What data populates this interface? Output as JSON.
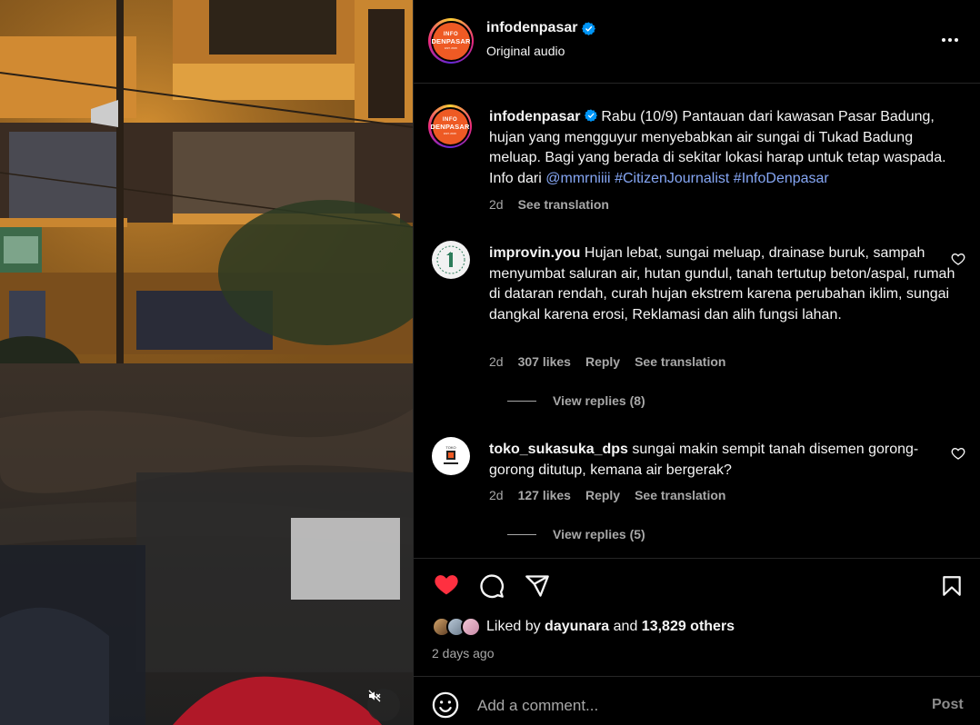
{
  "post": {
    "username": "infodenpasar",
    "audio": "Original audio",
    "avatar_logo": {
      "line1": "INFO",
      "line2": "DENPASAR",
      "line3": "EST. 2015"
    }
  },
  "caption": {
    "username": "infodenpasar",
    "text": "Rabu (10/9) Pantauan dari kawasan Pasar Badung, hujan yang mengguyur menyebabkan air sungai di Tukad Badung meluap. Bagi yang berada di sekitar lokasi harap untuk tetap waspada. Info dari",
    "mention": "@mmrniiii",
    "tag1": "#CitizenJournalist",
    "tag2": "#InfoDenpasar",
    "age": "2d",
    "see_translation": "See translation"
  },
  "comments": [
    {
      "username": "improvin.you",
      "text": "Hujan lebat, sungai meluap, drainase buruk, sampah menyumbat saluran air, hutan gundul, tanah tertutup beton/aspal, rumah di dataran rendah, curah hujan ekstrem karena perubahan iklim, sungai dangkal karena erosi, Reklamasi dan alih fungsi lahan.",
      "age": "2d",
      "likes": "307 likes",
      "reply": "Reply",
      "see_translation": "See translation",
      "view_replies": "View replies (8)",
      "avatar_text": "1"
    },
    {
      "username": "toko_sukasuka_dps",
      "text": "sungai makin sempit tanah disemen gorong-gorong ditutup, kemana air bergerak?",
      "age": "2d",
      "likes": "127 likes",
      "reply": "Reply",
      "see_translation": "See translation",
      "view_replies": "View replies (5)",
      "avatar_text": "TOKO"
    }
  ],
  "actions": {
    "liked_by_prefix": "Liked by",
    "liked_by_user": "dayunara",
    "and": "and",
    "others": "13,829 others",
    "timestamp": "2 days ago"
  },
  "composer": {
    "placeholder": "Add a comment...",
    "post_label": "Post"
  },
  "colors": {
    "background": "#000000",
    "text": "#f5f5f5",
    "secondary": "#a8a8a8",
    "link": "#86a7f5",
    "like_red": "#ff3040",
    "verified_blue": "#0095f6"
  },
  "icons": [
    "verified-icon",
    "more-icon",
    "heart-icon",
    "comment-icon",
    "share-icon",
    "bookmark-icon",
    "emoji-icon",
    "mute-icon"
  ]
}
